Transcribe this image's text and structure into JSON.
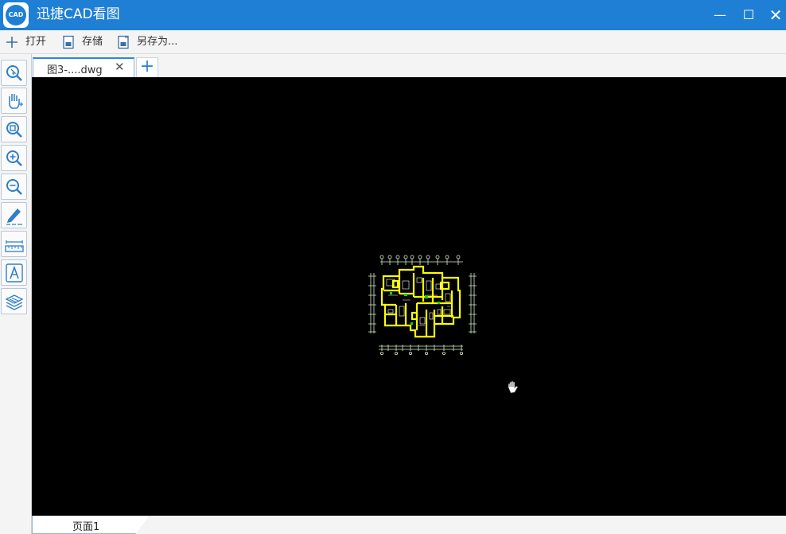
{
  "app": {
    "title": "迅捷CAD看图",
    "logo_text": "CAD"
  },
  "window_controls": {
    "minimize": "—",
    "maximize": "☐",
    "close": "✕"
  },
  "toolbar": {
    "open_label": "打开",
    "save_label": "存储",
    "save_as_label": "另存为..."
  },
  "sidebar": {
    "tools": [
      {
        "name": "zoom-window-tool",
        "icon": "magnify-arrow-icon"
      },
      {
        "name": "pan-tool",
        "icon": "hand-icon"
      },
      {
        "name": "zoom-extents-tool",
        "icon": "magnify-square-icon"
      },
      {
        "name": "zoom-in-tool",
        "icon": "zoom-in-icon"
      },
      {
        "name": "zoom-out-tool",
        "icon": "zoom-out-icon"
      },
      {
        "name": "annotate-tool",
        "icon": "pencil-icon"
      },
      {
        "name": "measure-tool",
        "icon": "ruler-icon"
      },
      {
        "name": "text-tool",
        "icon": "text-a-icon"
      },
      {
        "name": "layers-tool",
        "icon": "layers-icon"
      }
    ]
  },
  "tabs": [
    {
      "label": "图3-....dwg",
      "close": "✕"
    }
  ],
  "tab_add": "+",
  "layout_tabs": [
    {
      "label": "页面1"
    }
  ],
  "colors": {
    "accent": "#1f7fd4",
    "canvas": "#000000",
    "drawing": "#ffff00"
  }
}
